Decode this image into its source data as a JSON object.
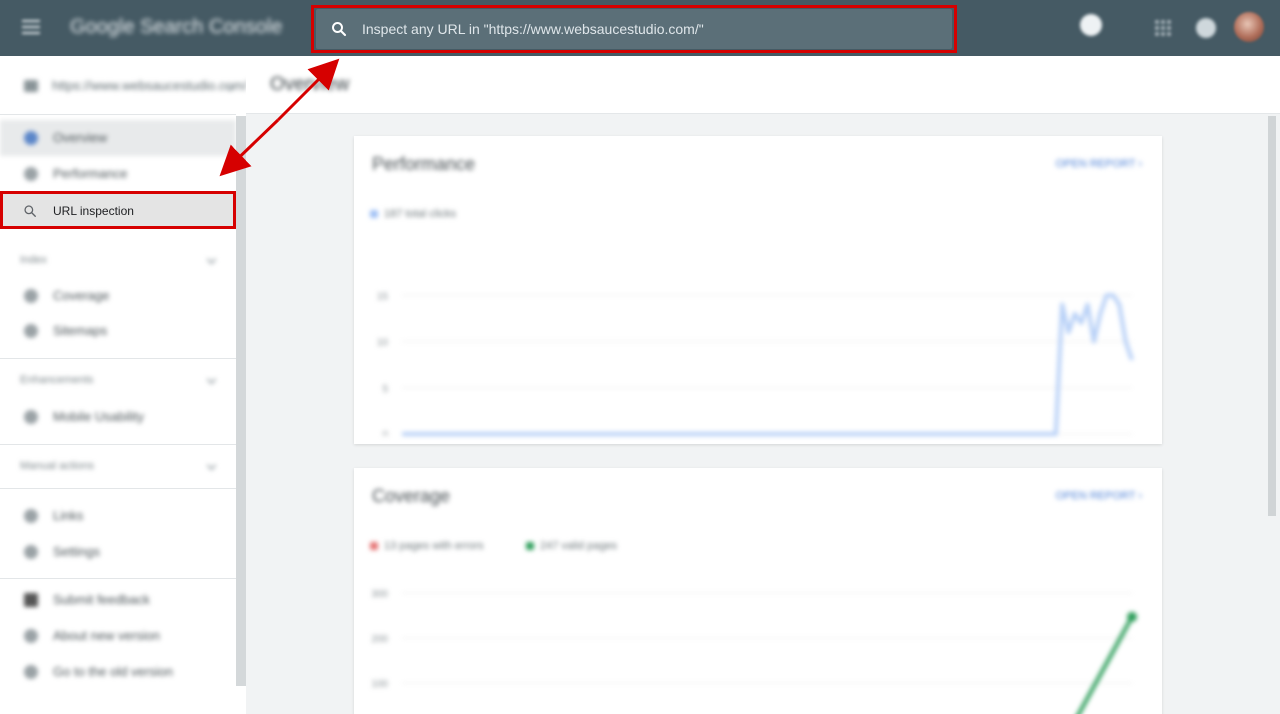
{
  "topbar": {
    "app_title": "Google Search Console",
    "search_placeholder": "Inspect any URL in \"https://www.websaucestudio.com/\"",
    "icons": [
      "menu-icon",
      "search-icon",
      "help-icon",
      "apps-icon",
      "notifications-icon",
      "avatar"
    ]
  },
  "sidebar": {
    "property": "https://www.websaucestudio.com/",
    "items": {
      "overview": "Overview",
      "performance": "Performance",
      "url_inspection": "URL inspection",
      "coverage": "Coverage",
      "sitemaps": "Sitemaps",
      "mobile_usability": "Mobile Usability",
      "links": "Links",
      "settings": "Settings",
      "submit_feedback": "Submit feedback",
      "about_new_version": "About new version",
      "old_version": "Go to the old version"
    },
    "sections": {
      "index": "Index",
      "enhancements": "Enhancements",
      "manual_actions": "Manual actions"
    }
  },
  "main": {
    "page_title": "Overview",
    "performance": {
      "title": "Performance",
      "link": "OPEN REPORT",
      "legend": "187 total clicks"
    },
    "coverage": {
      "title": "Coverage",
      "link": "OPEN REPORT",
      "legend_errors": "13 pages with errors",
      "legend_valid": "247 valid pages"
    }
  },
  "annotation": {
    "highlight_color": "#d60000"
  },
  "chart_data": [
    {
      "type": "line",
      "series": [
        {
          "name": "187 total clicks",
          "color": "#b7d0f7",
          "values": [
            0,
            0,
            0,
            0,
            0,
            0,
            0,
            0,
            0,
            0,
            0,
            0,
            0,
            0,
            0,
            0,
            0,
            0,
            0,
            0,
            0,
            0,
            0,
            0,
            0,
            0,
            0,
            0,
            0,
            0,
            0,
            0,
            0,
            0,
            0,
            0,
            0,
            0,
            0,
            0,
            0,
            0,
            0,
            0,
            0,
            0,
            0,
            0,
            0,
            0,
            0,
            0,
            0,
            0,
            0,
            0,
            0,
            0,
            0,
            0,
            0,
            0,
            0,
            0,
            0,
            0,
            0,
            0,
            0,
            0,
            0,
            0,
            0,
            0,
            0,
            0,
            0,
            0,
            0,
            0,
            0,
            0,
            0,
            0,
            0,
            0,
            0,
            0,
            0,
            0,
            0,
            0,
            0,
            0,
            0,
            0,
            0,
            0,
            0,
            0,
            0,
            0,
            0,
            0,
            14,
            11,
            13,
            12,
            14,
            10,
            13,
            15,
            15,
            14,
            10,
            8
          ]
        }
      ],
      "ylim": [
        0,
        16
      ],
      "yticks": [
        0,
        5,
        10,
        15
      ],
      "xticks": [
        "",
        "",
        "",
        "",
        "",
        "",
        "",
        "",
        ""
      ]
    },
    {
      "type": "line",
      "series": [
        {
          "name": "13 pages with errors",
          "color": "#e57373",
          "values": [
            0,
            0,
            0,
            0,
            0,
            0,
            0,
            0,
            0,
            0,
            0,
            0,
            0
          ]
        },
        {
          "name": "247 valid pages",
          "color": "#2e9e5b",
          "values": [
            0,
            0,
            0,
            0,
            0,
            0,
            0,
            0,
            0,
            0,
            0,
            0,
            247
          ]
        }
      ],
      "ylim": [
        0,
        300
      ],
      "yticks": [
        0,
        100,
        200,
        300
      ]
    }
  ]
}
